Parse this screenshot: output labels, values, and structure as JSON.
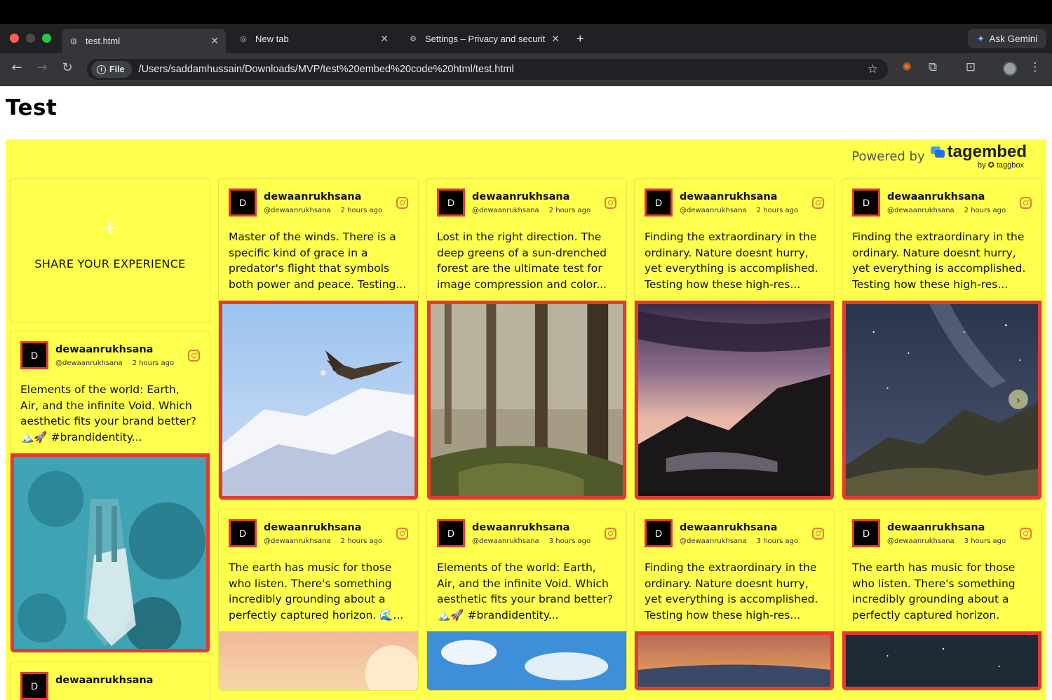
{
  "browser": {
    "tabs": [
      {
        "label": "test.html",
        "icon": "globe-icon"
      },
      {
        "label": "New tab",
        "icon": "chrome-icon"
      },
      {
        "label": "Settings – Privacy and securit",
        "icon": "gear-icon"
      }
    ],
    "new_tab": "+",
    "gemini": "Ask Gemini",
    "file_chip": "File",
    "url": "/Users/saddamhussain/Downloads/MVP/test%20embed%20code%20html/test.html"
  },
  "page": {
    "title": "Test",
    "powered_by": "Powered by",
    "brand": "tagembed",
    "brand_sub": "by ✪ taggbox",
    "share_label": "SHARE YOUR EXPERIENCE",
    "share_plus": "+",
    "colors": {
      "wall": "#ffff4d",
      "accent": "#e53935"
    }
  },
  "posts": [
    {
      "avatar": "D",
      "name": "dewaanrukhsana",
      "handle": "@dewaanrukhsana",
      "time": "2 hours ago",
      "text": "Elements of the world: Earth, Air, and the infinite Void. Which aesthetic fits your brand better? 🏔️🚀 #brandidentity..."
    },
    {
      "avatar": "D",
      "name": "dewaanrukhsana",
      "handle": "@dewaanrukhsana",
      "time": "2 hours ago",
      "text": "Master of the winds. There is a specific kind of grace in a predator's flight that symbols both power and peace. Testing..."
    },
    {
      "avatar": "D",
      "name": "dewaanrukhsana",
      "handle": "@dewaanrukhsana",
      "time": "2 hours ago",
      "text": "Lost in the right direction. The deep greens of a sun-drenched forest are the ultimate test for image compression and color..."
    },
    {
      "avatar": "D",
      "name": "dewaanrukhsana",
      "handle": "@dewaanrukhsana",
      "time": "2 hours ago",
      "text": "Finding the extraordinary in the ordinary. Nature doesnt hurry, yet everything is accomplished. Testing how these high-res..."
    },
    {
      "avatar": "D",
      "name": "dewaanrukhsana",
      "handle": "@dewaanrukhsana",
      "time": "2 hours ago",
      "text": "Finding the extraordinary in the ordinary. Nature doesnt hurry, yet everything is accomplished. Testing how these high-res..."
    },
    {
      "avatar": "D",
      "name": "dewaanrukhsana",
      "handle": "@dewaanrukhsana",
      "time": "2 hours ago",
      "text": "The earth has music for those who listen. There's something incredibly grounding about a perfectly captured horizon. 🌊..."
    },
    {
      "avatar": "D",
      "name": "dewaanrukhsana",
      "handle": "@dewaanrukhsana",
      "time": "3 hours ago",
      "text": "Elements of the world: Earth, Air, and the infinite Void. Which aesthetic fits your brand better? 🏔️🚀 #brandidentity..."
    },
    {
      "avatar": "D",
      "name": "dewaanrukhsana",
      "handle": "@dewaanrukhsana",
      "time": "3 hours ago",
      "text": "Finding the extraordinary in the ordinary. Nature doesnt hurry, yet everything is accomplished. Testing how these high-res..."
    },
    {
      "avatar": "D",
      "name": "dewaanrukhsana",
      "handle": "@dewaanrukhsana",
      "time": "3 hours ago",
      "text": "The earth has music for those who listen. There's something incredibly grounding about a perfectly captured horizon."
    },
    {
      "avatar": "D",
      "name": "dewaanrukhsana"
    }
  ]
}
